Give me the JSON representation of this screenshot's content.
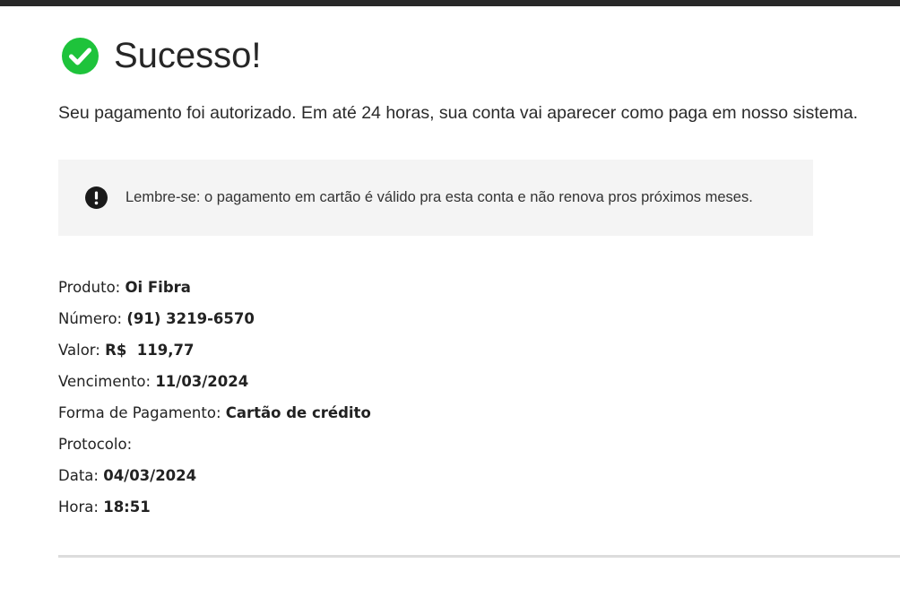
{
  "header": {
    "title": "Sucesso!",
    "success_color": "#1ec33b",
    "icon": "check-circle-icon"
  },
  "message": "Seu pagamento foi autorizado. Em até 24 horas, sua conta vai aparecer como paga em nosso sistema.",
  "notice": {
    "icon": "exclamation-circle-icon",
    "text": "Lembre-se: o pagamento em cartão é válido pra esta conta e não renova pros próximos meses."
  },
  "details": [
    {
      "label": "Produto:",
      "value": "Oi Fibra"
    },
    {
      "label": "Número:",
      "value": "(91) 3219-6570"
    },
    {
      "label": "Valor:",
      "value": "R$  119,77"
    },
    {
      "label": "Vencimento:",
      "value": "11/03/2024"
    },
    {
      "label": "Forma de Pagamento:",
      "value": "Cartão de crédito"
    },
    {
      "label": "Protocolo:",
      "value": ""
    },
    {
      "label": "Data:",
      "value": "04/03/2024"
    },
    {
      "label": "Hora:",
      "value": "18:51"
    }
  ]
}
